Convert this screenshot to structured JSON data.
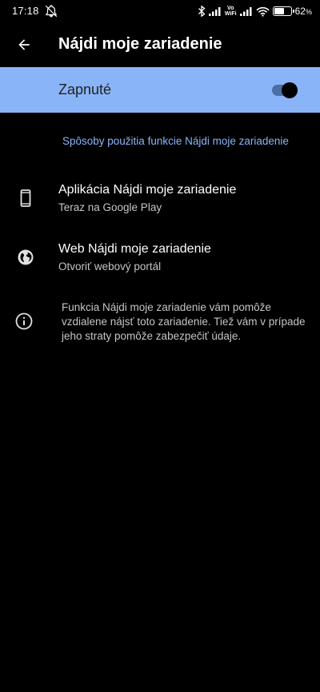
{
  "status_bar": {
    "time": "17:18",
    "volte_top": "Vo",
    "volte_bottom": "WiFi",
    "battery_percent": "62",
    "battery_unit": "%",
    "battery_level": 0.62
  },
  "app_bar": {
    "title": "Nájdi moje zariadenie"
  },
  "toggle": {
    "label": "Zapnuté",
    "checked": true
  },
  "section": {
    "header": "Spôsoby použitia funkcie Nájdi moje zariadenie"
  },
  "items": [
    {
      "title": "Aplikácia Nájdi moje zariadenie",
      "subtitle": "Teraz na Google Play",
      "icon": "phone-icon"
    },
    {
      "title": "Web Nájdi moje zariadenie",
      "subtitle": "Otvoriť webový portál",
      "icon": "globe-icon"
    }
  ],
  "info": {
    "text": "Funkcia Nájdi moje zariadenie vám pomôže vzdialene nájsť toto zariadenie. Tiež vám v prípade jeho straty pomôže zabezpečiť údaje."
  },
  "colors": {
    "accent": "#8ab4f8",
    "background": "#000000",
    "secondary_text": "#c5c5c5"
  }
}
